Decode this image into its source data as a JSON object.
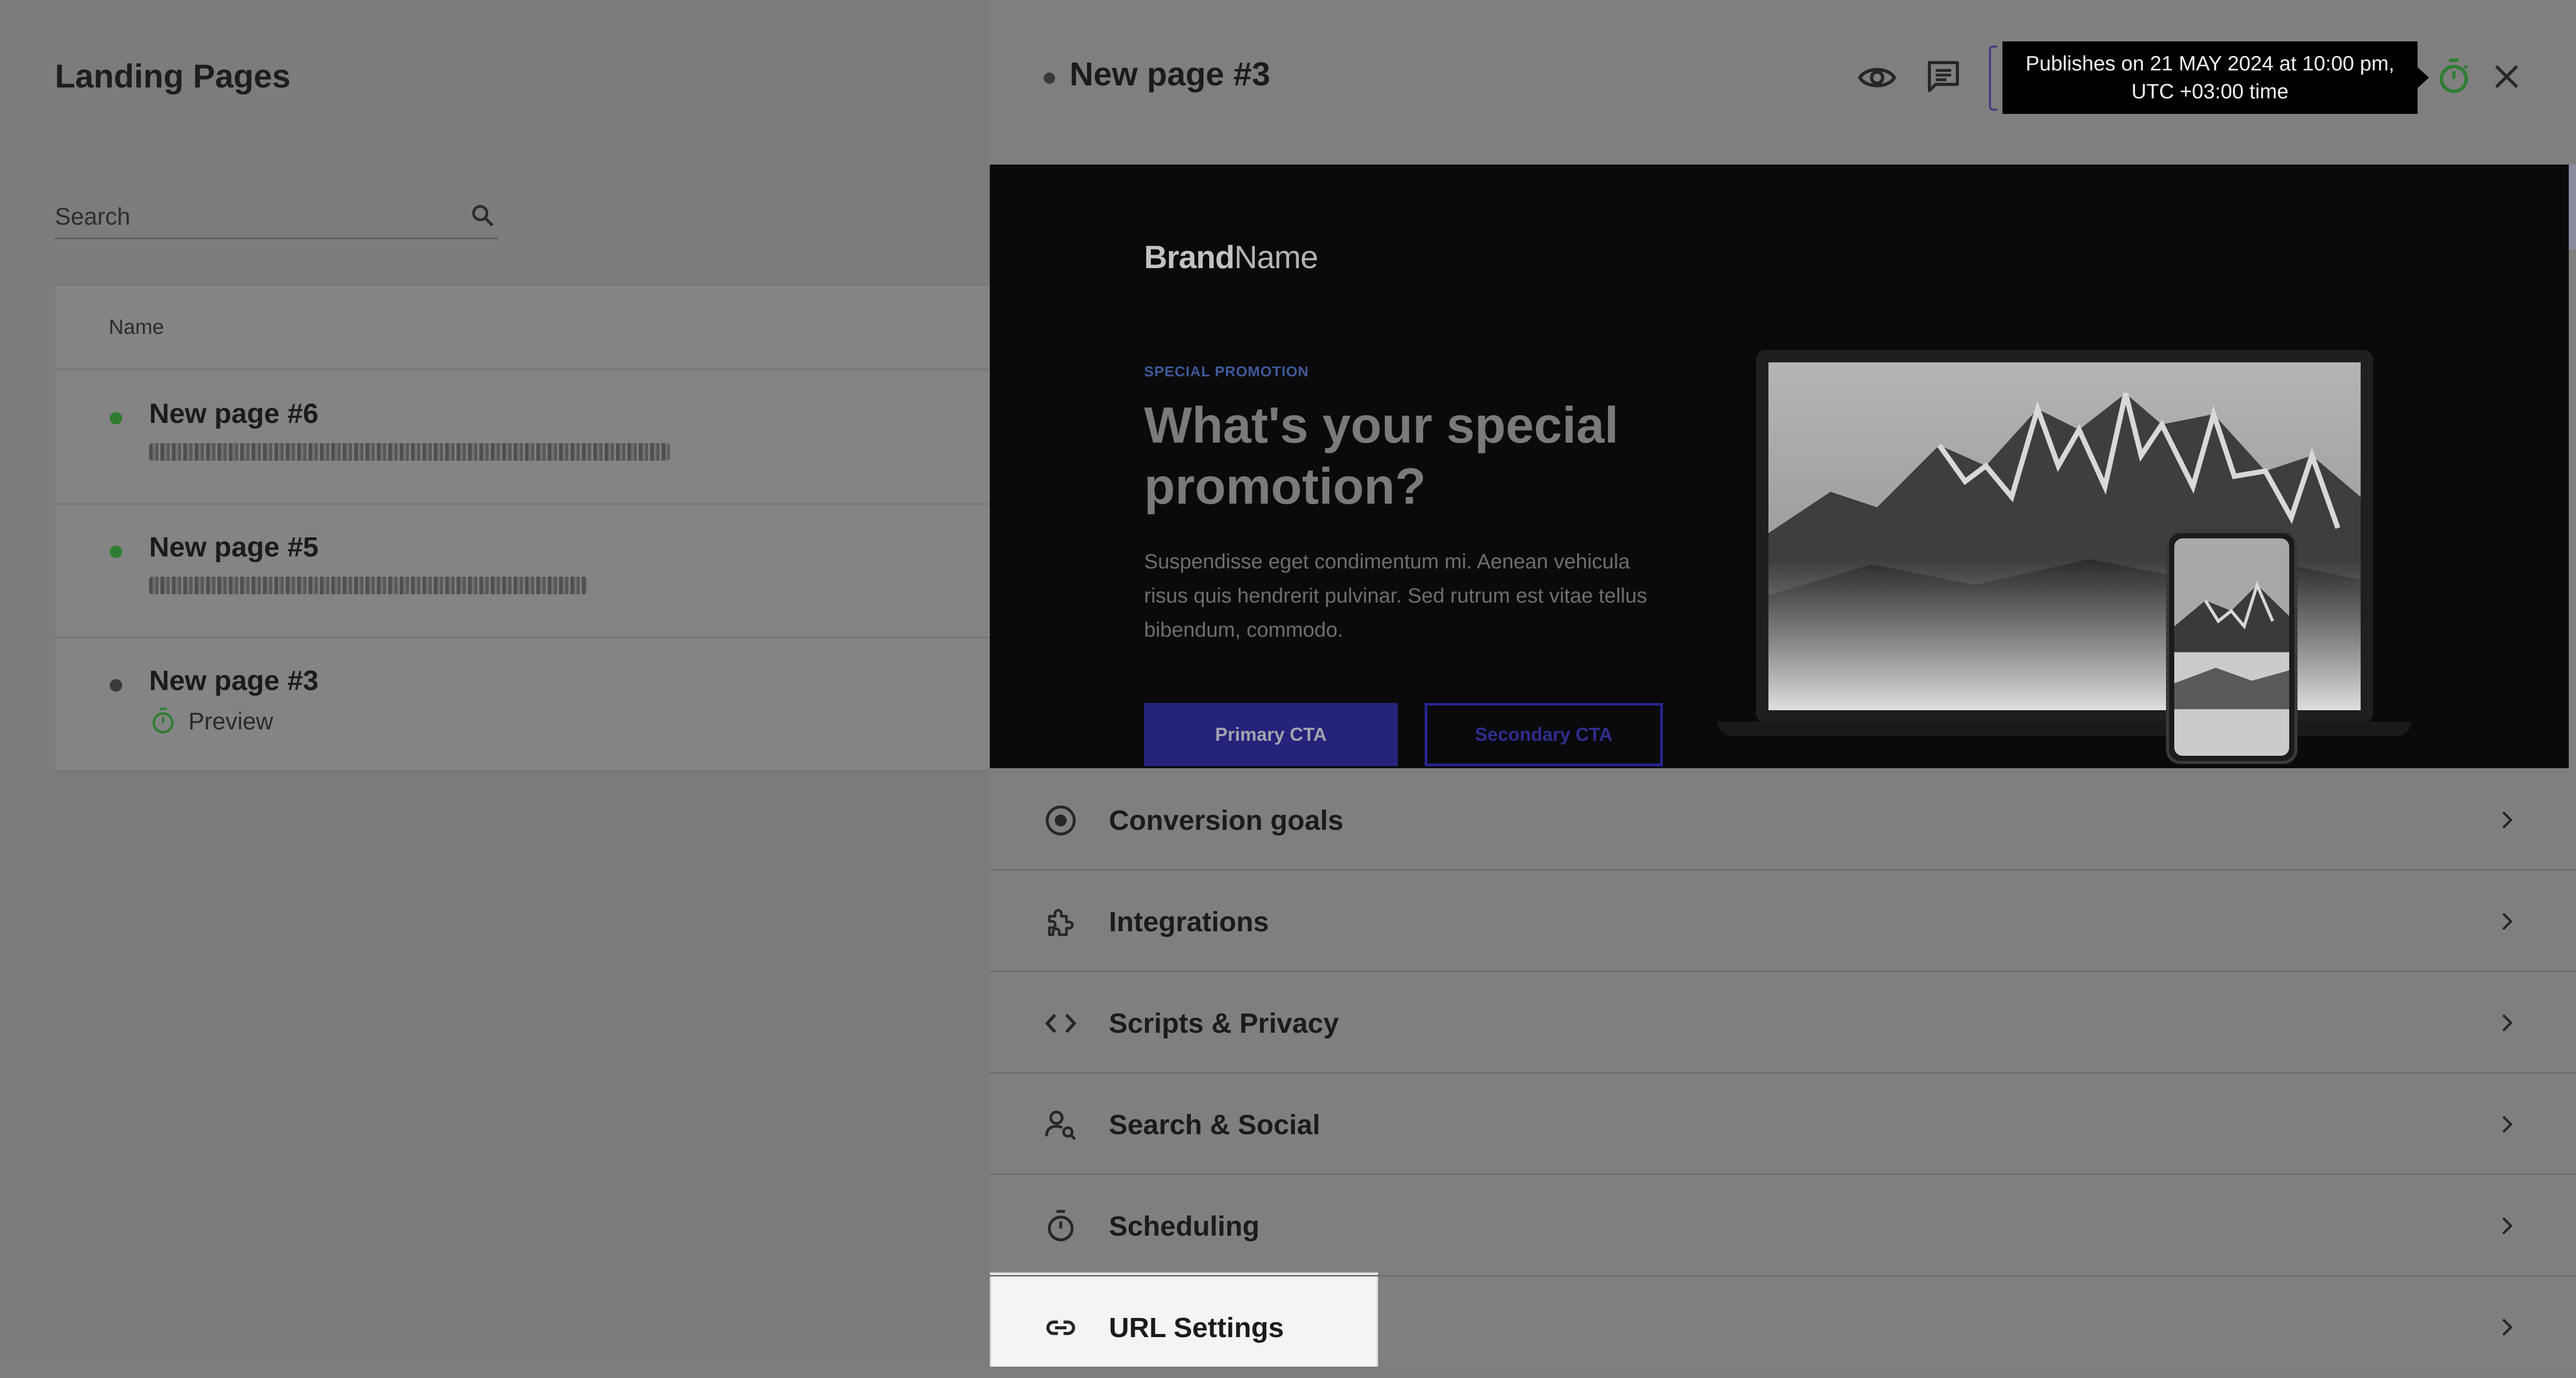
{
  "left_panel": {
    "title": "Landing Pages",
    "search": {
      "placeholder": "Search",
      "value": ""
    },
    "table": {
      "column_name": "Name",
      "rows": [
        {
          "title": "New page #6",
          "status_color": "#2e7d32",
          "subtitle_blurred": true
        },
        {
          "title": "New page #5",
          "status_color": "#2e7d32",
          "subtitle_blurred": true
        },
        {
          "title": "New page #3",
          "status_color": "#3a3a3a",
          "preview_label": "Preview"
        }
      ]
    }
  },
  "drawer": {
    "page_title": "New page #3",
    "header_icons": [
      "eye-icon",
      "comment-icon",
      "timer-icon",
      "close-icon"
    ],
    "tooltip": {
      "line1": "Publishes on 21 MAY 2024 at 10:00 pm,",
      "line2": "UTC +03:00 time"
    },
    "preview": {
      "brand_bold": "Brand",
      "brand_light": "Name",
      "eyebrow": "SPECIAL PROMOTION",
      "headline": "What's your special promotion?",
      "body": "Suspendisse eget condimentum mi. Aenean vehicula risus quis hendrerit pulvinar. Sed rutrum est vitae tellus bibendum, commodo.",
      "primary_cta": "Primary CTA",
      "secondary_cta": "Secondary CTA"
    },
    "settings": [
      {
        "label": "Conversion goals",
        "icon": "target-icon"
      },
      {
        "label": "Integrations",
        "icon": "puzzle-icon"
      },
      {
        "label": "Scripts & Privacy",
        "icon": "code-icon"
      },
      {
        "label": "Search & Social",
        "icon": "person-search-icon"
      },
      {
        "label": "Scheduling",
        "icon": "timer-icon"
      },
      {
        "label": "URL Settings",
        "icon": "link-icon"
      }
    ]
  },
  "colors": {
    "accent_green": "#2e7d32",
    "cta_blue": "#25237a",
    "eyebrow_blue": "#3d5a98"
  }
}
